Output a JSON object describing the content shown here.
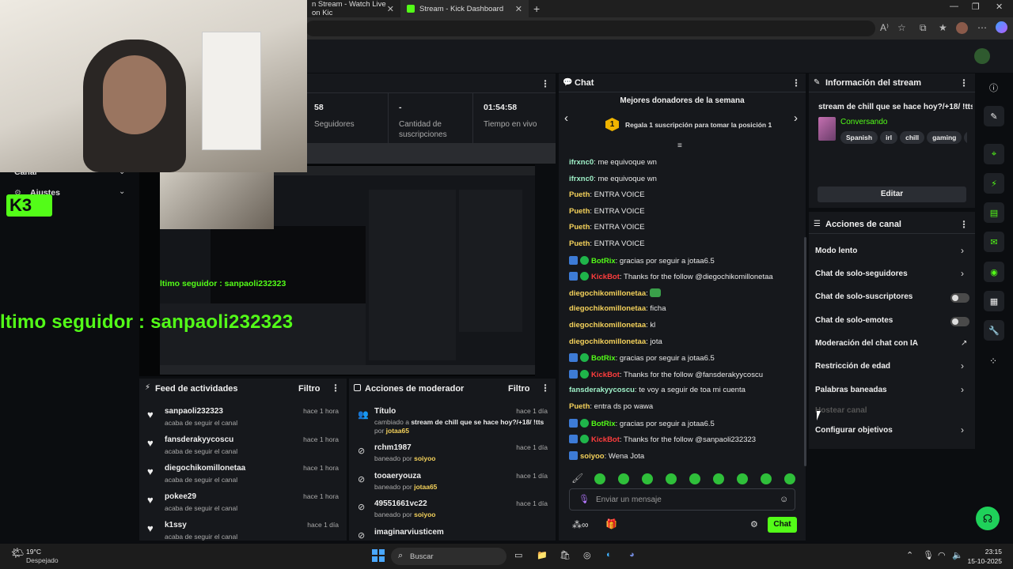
{
  "browser": {
    "tabs": [
      {
        "label": "n Stream - Watch Live on Kic"
      },
      {
        "label": "Stream - Kick Dashboard"
      }
    ],
    "new_tab": "+"
  },
  "stats": {
    "followers_value": "58",
    "followers_label": "Seguidores",
    "subs_value": "-",
    "subs_label": "Cantidad de suscripciones",
    "live_value": "01:54:58",
    "live_label": "Tiempo en vivo"
  },
  "sidebar": {
    "canal": "Canal",
    "ajustes": "Ajustes"
  },
  "overlay": {
    "follower_text": "ltimo seguidor : sanpaoli232323",
    "follower_text_small": "ltimo seguidor : sanpaoli232323"
  },
  "activity": {
    "title": "Feed de actividades",
    "filter": "Filtro",
    "items": [
      {
        "name": "sanpaoli232323",
        "sub": "acaba de seguir el canal",
        "time": "hace 1 hora"
      },
      {
        "name": "fansderakyycoscu",
        "sub": "acaba de seguir el canal",
        "time": "hace 1 hora"
      },
      {
        "name": "diegochikomillonetaa",
        "sub": "acaba de seguir el canal",
        "time": "hace 1 hora"
      },
      {
        "name": "pokee29",
        "sub": "acaba de seguir el canal",
        "time": "hace 1 hora"
      },
      {
        "name": "k1ssy",
        "sub": "acaba de seguir el canal",
        "time": "hace 1 día"
      }
    ]
  },
  "modactions": {
    "title": "Acciones de moderador",
    "filter": "Filtro",
    "items": [
      {
        "name": "Título",
        "line1": "cambiado a ",
        "line1b": "stream de chill que se hace hoy?/+18/ !tts",
        "by": "por ",
        "user": "jotaa65",
        "time": "hace 1 día"
      },
      {
        "name": "rchm1987",
        "by": "baneado por ",
        "user": "soiyoo",
        "time": "hace 1 día"
      },
      {
        "name": "tooaeryouza",
        "by": "baneado por ",
        "user": "jotaa65",
        "time": "hace 1 día"
      },
      {
        "name": "49551661vc22",
        "by": "baneado por ",
        "user": "soiyoo",
        "time": "hace 1 día"
      },
      {
        "name": "imaginarviusticem",
        "by": "",
        "user": "",
        "time": ""
      }
    ]
  },
  "chat": {
    "title": "Chat",
    "top_donors_title": "Mejores donadores de la semana",
    "top_donors_rank": "1",
    "top_donors_text": "Regala 1 suscripción para tomar la posición 1",
    "messages": [
      {
        "user": "ifrxnc0",
        "text": "me equivoque wn",
        "color": "mint"
      },
      {
        "user": "ifrxnc0",
        "text": "me equivoque wn",
        "color": "mint"
      },
      {
        "user": "Pueth",
        "text": "ENTRA VOICE",
        "color": "yellow"
      },
      {
        "user": "Pueth",
        "text": "ENTRA VOICE",
        "color": "yellow"
      },
      {
        "user": "Pueth",
        "text": "ENTRA VOICE",
        "color": "yellow"
      },
      {
        "user": "Pueth",
        "text": "ENTRA VOICE",
        "color": "yellow"
      },
      {
        "user": "BotRix",
        "text": "gracias por seguir a jotaa6.5",
        "color": "green",
        "badges": true
      },
      {
        "user": "KickBot",
        "text": "Thanks for the follow @diegochikomillonetaa",
        "color": "red",
        "badges": true
      },
      {
        "user": "diegochikomillonetaa",
        "text": "",
        "color": "yellow",
        "emote": true
      },
      {
        "user": "diegochikomillonetaa",
        "text": "ficha",
        "color": "yellow"
      },
      {
        "user": "diegochikomillonetaa",
        "text": "kl",
        "color": "yellow"
      },
      {
        "user": "diegochikomillonetaa",
        "text": "jota",
        "color": "yellow"
      },
      {
        "user": "BotRix",
        "text": "gracias por seguir a jotaa6.5",
        "color": "green",
        "badges": true
      },
      {
        "user": "KickBot",
        "text": "Thanks for the follow @fansderakyycoscu",
        "color": "red",
        "badges": true
      },
      {
        "user": "fansderakyycoscu",
        "text": "te voy a seguir de toa mi cuenta",
        "color": "mint"
      },
      {
        "user": "Pueth",
        "text": "entra ds po wawa",
        "color": "yellow"
      },
      {
        "user": "BotRix",
        "text": "gracias por seguir a jotaa6.5",
        "color": "green",
        "badges": true
      },
      {
        "user": "KickBot",
        "text": "Thanks for the follow @sanpaoli232323",
        "color": "red",
        "badges": true
      },
      {
        "user": "soiyoo",
        "text": "Wena Jota",
        "color": "yellow",
        "badge_one": true
      }
    ],
    "input_placeholder": "Enviar un mensaje",
    "send_label": "Chat"
  },
  "stream_info": {
    "title": "Información del stream",
    "stream_title": "stream de chill que se hace hoy?/+18/ !tts",
    "category": "Conversando",
    "tags": [
      "Spanish",
      "irl",
      "chill",
      "gaming",
      "Cl"
    ],
    "edit_label": "Editar"
  },
  "channel_actions": {
    "title": "Acciones de canal",
    "options": [
      {
        "label": "Modo lento",
        "control": "chevron"
      },
      {
        "label": "Chat de solo-seguidores",
        "control": "chevron"
      },
      {
        "label": "Chat de solo-suscriptores",
        "control": "toggle"
      },
      {
        "label": "Chat de solo-emotes",
        "control": "toggle"
      },
      {
        "label": "Moderación del chat con IA",
        "control": "external"
      },
      {
        "label": "Restricción de edad",
        "control": "chevron"
      },
      {
        "label": "Palabras baneadas",
        "control": "chevron"
      },
      {
        "label": "Hostear canal",
        "control": "none"
      },
      {
        "label": "Configurar objetivos",
        "control": "chevron"
      }
    ]
  },
  "taskbar": {
    "weather_temp": "19°C",
    "weather_desc": "Despejado",
    "search": "Buscar",
    "time": "23:15",
    "date": "15-10-2025"
  },
  "colors": {
    "kick_green": "#53fc18",
    "panel_bg": "#16181c",
    "page_bg": "#0b0d10"
  }
}
